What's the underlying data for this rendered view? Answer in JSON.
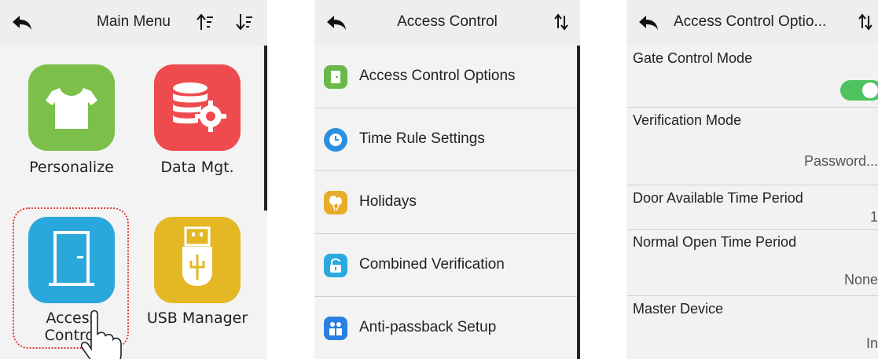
{
  "screen1": {
    "title": "Main Menu",
    "tiles": [
      {
        "label": "Personalize",
        "color": "#7cc04b"
      },
      {
        "label": "Data Mgt.",
        "color": "#ee4b4f"
      },
      {
        "label": "Access Control",
        "label_line1": "Access",
        "label_line2": "Control",
        "color": "#2aa8dc"
      },
      {
        "label": "USB Manager",
        "color": "#e4b724"
      }
    ]
  },
  "screen2": {
    "title": "Access Control",
    "items": [
      {
        "label": "Access Control Options",
        "icon": "door-icon",
        "color": "#6ab84a"
      },
      {
        "label": "Time Rule Settings",
        "icon": "clock-icon",
        "color": "#2a8fe0"
      },
      {
        "label": "Holidays",
        "icon": "balloon-icon",
        "color": "#e8ac2a"
      },
      {
        "label": "Combined Verification",
        "icon": "lock-icon",
        "color": "#29a9e0"
      },
      {
        "label": "Anti-passback Setup",
        "icon": "users-icon",
        "color": "#2a7fe0"
      }
    ]
  },
  "screen3": {
    "title": "Access Control Optio...",
    "options": [
      {
        "name": "Gate Control Mode",
        "value": "",
        "toggle": true
      },
      {
        "name": "Verification Mode",
        "value": "Password..."
      },
      {
        "name": "Door Available Time Period",
        "value": "1"
      },
      {
        "name": "Normal Open Time Period",
        "value": "None"
      },
      {
        "name": "Master Device",
        "value": "In"
      }
    ],
    "toggle_color": "#4fc35f"
  }
}
